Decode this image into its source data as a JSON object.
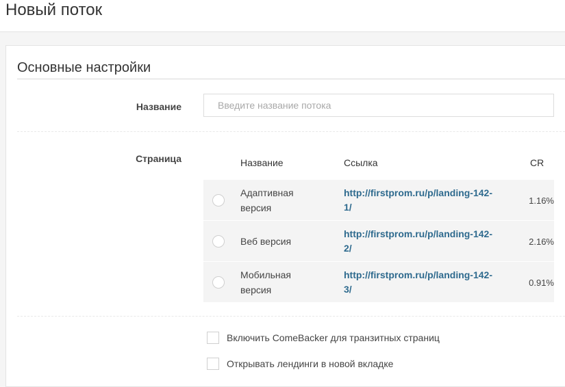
{
  "header": {
    "title": "Новый поток"
  },
  "section": {
    "title": "Основные настройки"
  },
  "form": {
    "name_label": "Название",
    "name_placeholder": "Введите название потока",
    "name_value": "",
    "page_label": "Страница"
  },
  "table": {
    "columns": {
      "name": "Название",
      "link": "Ссылка",
      "cr": "CR"
    },
    "rows": [
      {
        "name": "Адаптивная версия",
        "link": "http://firstprom.ru/p/landing-142-1/",
        "cr": "1.16%",
        "selected": false
      },
      {
        "name": "Веб версия",
        "link": "http://firstprom.ru/p/landing-142-2/",
        "cr": "2.16%",
        "selected": false
      },
      {
        "name": "Мобильная версия",
        "link": "http://firstprom.ru/p/landing-142-3/",
        "cr": "0.91%",
        "selected": false
      }
    ]
  },
  "options": {
    "comebacker_label": "Включить ComeBacker для транзитных страниц",
    "comebacker_checked": false,
    "new_tab_label": "Открывать лендинги в новой вкладке",
    "new_tab_checked": false
  },
  "colors": {
    "link": "#2e6a8e",
    "row_bg": "#f4f4f4",
    "border": "#dcdcdc"
  }
}
